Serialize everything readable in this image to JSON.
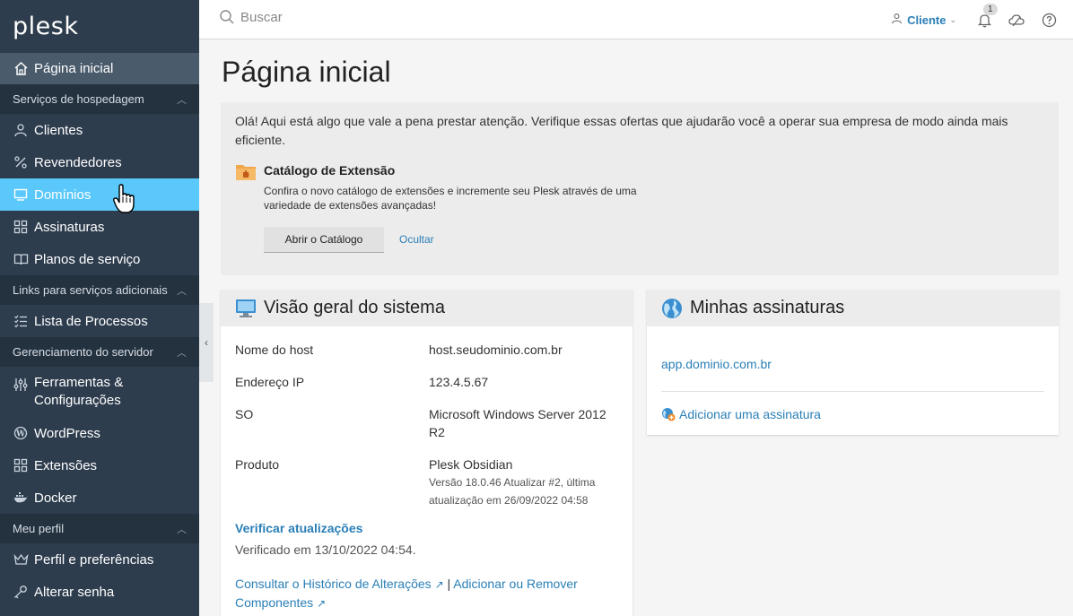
{
  "sidebar": {
    "logo": "plesk",
    "home": "Página inicial",
    "sections": {
      "hosting": "Serviços de hospedagem",
      "links": "Links para serviços adicionais",
      "server": "Gerenciamento do servidor",
      "profile": "Meu perfil"
    },
    "items": {
      "clients": "Clientes",
      "resellers": "Revendedores",
      "domains": "Domínios",
      "subscriptions": "Assinaturas",
      "plans": "Planos de serviço",
      "processes": "Lista de Processos",
      "tools_line1": "Ferramentas &",
      "tools_line2": "Configurações",
      "wordpress": "WordPress",
      "extensions": "Extensões",
      "docker": "Docker",
      "profile_prefs": "Perfil e preferências",
      "change_password": "Alterar senha"
    }
  },
  "topbar": {
    "search_placeholder": "Buscar",
    "client_label": "Cliente",
    "notifications_count": "1"
  },
  "main": {
    "title": "Página inicial",
    "promo": {
      "text": "Olá! Aqui está algo que vale a pena prestar atenção. Verifique essas ofertas que ajudarão você a operar sua empresa de modo ainda mais eficiente.",
      "title": "Catálogo de Extensão",
      "desc": "Confira o novo catálogo de extensões e incremente seu Plesk através de uma variedade de extensões avançadas!",
      "open_button": "Abrir o Catálogo",
      "hide_link": "Ocultar"
    },
    "overview": {
      "title": "Visão geral do sistema",
      "hostname_label": "Nome do host",
      "hostname_value": "host.seudominio.com.br",
      "ip_label": "Endereço IP",
      "ip_value": "123.4.5.67",
      "os_label": "SO",
      "os_value": "Microsoft Windows Server 2012 R2",
      "product_label": "Produto",
      "product_value": "Plesk Obsidian",
      "version_line1": "Versão 18.0.46 Atualizar #2, última",
      "version_line2": "atualização em 26/09/2022 04:58",
      "check_updates": "Verificar atualizações",
      "checked_at": "Verificado em 13/10/2022 04:54.",
      "changelog_link": "Consultar o Histórico de Alterações",
      "separator": "|",
      "components_link_1": "Adicionar ou Remover",
      "components_link_2": "Componentes"
    },
    "subscriptions": {
      "title": "Minhas assinaturas",
      "domain": "app.dominio.com.br",
      "add_link": "Adicionar uma assinatura"
    }
  },
  "colors": {
    "sidebar_bg": "#2e3d4e",
    "active_bg": "#5ac8fa",
    "link": "#2a7fb7"
  }
}
